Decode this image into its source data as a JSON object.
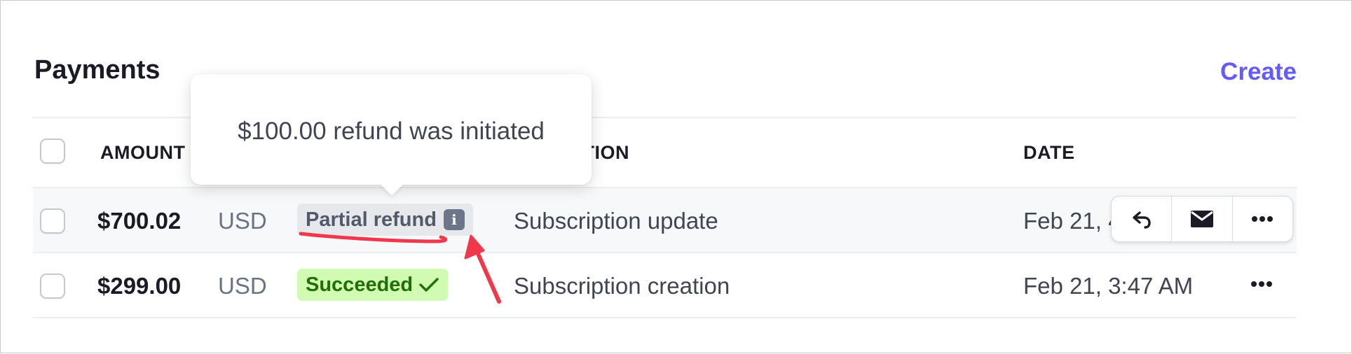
{
  "header": {
    "title": "Payments",
    "create_label": "Create"
  },
  "table": {
    "columns": [
      "AMOUNT",
      "DESCRIPTION",
      "DATE"
    ],
    "description_header_visible": "PTION",
    "rows": [
      {
        "amount": "$700.02",
        "currency": "USD",
        "status": "Partial refund",
        "description": "Subscription update",
        "date": "Feb 21, 4"
      },
      {
        "amount": "$299.00",
        "currency": "USD",
        "status": "Succeeded",
        "description": "Subscription creation",
        "date": "Feb 21, 3:47 AM"
      }
    ]
  },
  "row_actions": [
    "undo-icon",
    "envelope-icon",
    "more-icon"
  ],
  "tooltip": {
    "text": "$100.00 refund was initiated"
  },
  "annotation": {
    "color": "#f0384c"
  },
  "colors": {
    "accent": "#635bff",
    "success_bg": "#d1fab3",
    "success_text": "#217005",
    "neutral_badge_bg": "#e6e8ec"
  }
}
